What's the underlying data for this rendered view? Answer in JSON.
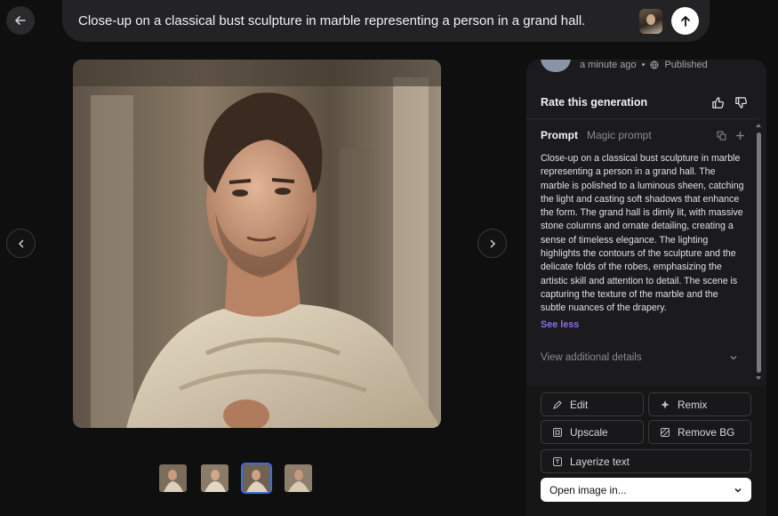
{
  "header": {
    "prompt_text": "Close-up on a classical bust sculpture in marble representing a person in a grand hall."
  },
  "panel": {
    "timestamp": "a minute ago",
    "status": "Published",
    "rate_label": "Rate this generation",
    "tabs": [
      "Prompt",
      "Magic prompt"
    ],
    "prompt_body": "Close-up on a classical bust sculpture in marble representing a person in a grand hall. The marble is polished to a luminous sheen, catching the light and casting soft shadows that enhance the form. The grand hall is dimly lit, with massive stone columns and ornate detailing, creating a sense of timeless elegance. The lighting highlights the contours of the sculpture and the delicate folds of the robes, emphasizing the artistic skill and attention to detail. The scene is capturing the texture of the marble and the subtle nuances of the drapery.",
    "see_less": "See less",
    "details_label": "View additional details",
    "actions": {
      "edit": "Edit",
      "remix": "Remix",
      "upscale": "Upscale",
      "remove_bg": "Remove BG",
      "layerize": "Layerize text"
    },
    "open_label": "Open image in..."
  },
  "thumbnails": {
    "count": 4,
    "active_index": 2
  },
  "colors": {
    "accent": "#8b6cf0",
    "active_thumb": "#3b6fe0",
    "background": "#0f0f10",
    "panel": "#1b1b1d"
  },
  "icons": [
    "arrow-left-icon",
    "arrow-up-icon",
    "chevron-left-icon",
    "chevron-right-icon",
    "thumbs-up-icon",
    "thumbs-down-icon",
    "copy-icon",
    "plus-icon",
    "globe-icon",
    "chevron-down-icon",
    "edit-icon",
    "sparkle-icon",
    "upscale-icon",
    "remove-bg-icon",
    "layerize-icon"
  ]
}
